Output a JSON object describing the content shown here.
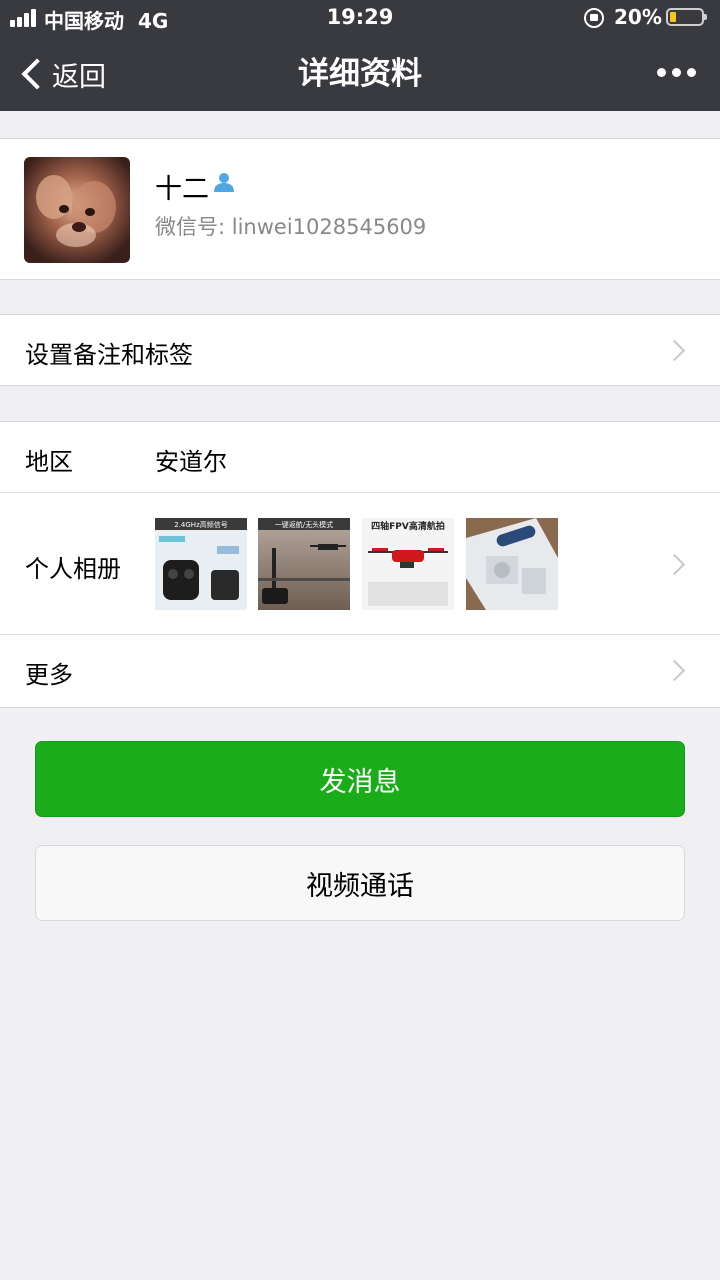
{
  "status_bar": {
    "carrier": "中国移动",
    "network": "4G",
    "time": "19:29",
    "battery": "20%",
    "battery_level": 0.2,
    "battery_color": "#f5c518"
  },
  "nav": {
    "back_label": "返回",
    "title": "详细资料",
    "more_icon": "more-dots-icon"
  },
  "profile": {
    "name": "十二",
    "wechat_id_label": "微信号:",
    "wechat_id": "linwei1028545609",
    "badge_icon": "person-icon",
    "badge_color": "#4fa7e4"
  },
  "remark_row": {
    "label": "设置备注和标签"
  },
  "region_row": {
    "label": "地区",
    "value": "安道尔"
  },
  "album_row": {
    "label": "个人相册",
    "photos": [
      {
        "caption": "2.4GHz高频信号"
      },
      {
        "caption": "一键返航/无头模式"
      },
      {
        "caption": "四轴FPV高清航拍"
      },
      {
        "caption": ""
      }
    ]
  },
  "more_row": {
    "label": "更多"
  },
  "buttons": {
    "send_message": "发消息",
    "video_call": "视频通话",
    "accent": "#1aad19"
  }
}
